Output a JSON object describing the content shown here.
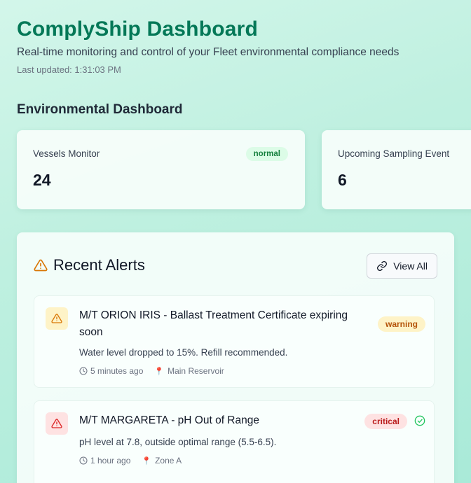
{
  "header": {
    "title": "ComplyShip Dashboard",
    "subtitle": "Real-time monitoring and control of your Fleet environmental compliance needs",
    "last_updated": "Last updated: 1:31:03 PM"
  },
  "section_title": "Environmental Dashboard",
  "cards": [
    {
      "label": "Vessels Monitor",
      "value": "24",
      "badge": "normal"
    },
    {
      "label": "Upcoming Sampling Event",
      "value": "6"
    }
  ],
  "alerts_panel": {
    "title": "Recent Alerts",
    "view_all_label": "View All",
    "alerts": [
      {
        "title": "M/T ORION IRIS - Ballast Treatment Certificate expiring soon",
        "description": "Water level dropped to 15%. Refill recommended.",
        "time": "5 minutes ago",
        "location": "Main Reservoir",
        "severity": "warning"
      },
      {
        "title": "M/T MARGARETA - pH Out of Range",
        "description": "pH level at 7.8, outside optimal range (5.5-6.5).",
        "time": "1 hour ago",
        "location": "Zone A",
        "severity": "critical"
      }
    ]
  },
  "colors": {
    "brand": "#047857",
    "warning": "#d97706",
    "critical": "#dc2626",
    "success": "#22c55e"
  }
}
